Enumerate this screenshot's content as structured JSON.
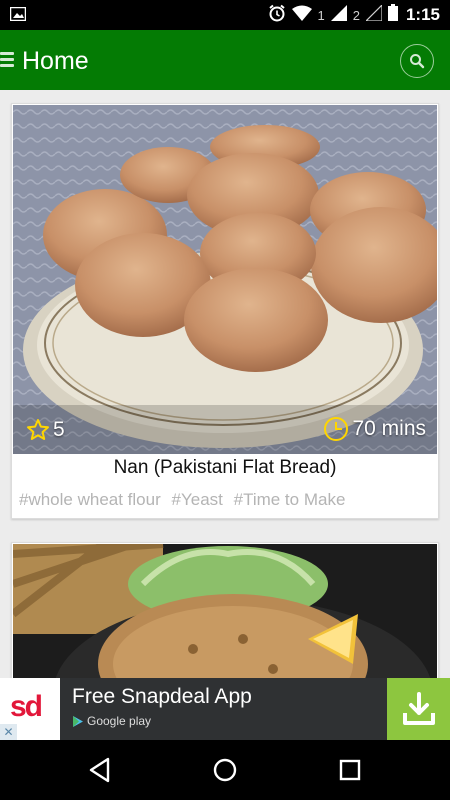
{
  "status_bar": {
    "sim1": "1",
    "sim2": "2",
    "time": "1:15",
    "icons": [
      "image-notification-icon",
      "alarm-icon",
      "wifi-icon",
      "signal-icon",
      "battery-icon"
    ]
  },
  "app_bar": {
    "title": "Home",
    "icons": [
      "menu-icon",
      "search-icon"
    ],
    "color": "#047b04"
  },
  "recipes": [
    {
      "rating": "5",
      "time": "70 mins",
      "title": "Nan (Pakistani Flat Bread)",
      "tags": [
        "#whole wheat flour",
        "#Yeast",
        "#Time to Make"
      ]
    }
  ],
  "ad": {
    "logo_text": "sd",
    "title": "Free Snapdeal App",
    "store_label": "Google play",
    "close_icon": "close-icon",
    "cta_icon": "download-icon",
    "cta_color": "#8dc63f"
  },
  "nav_bar": {
    "icons": [
      "back-icon",
      "home-icon",
      "recents-icon"
    ]
  }
}
